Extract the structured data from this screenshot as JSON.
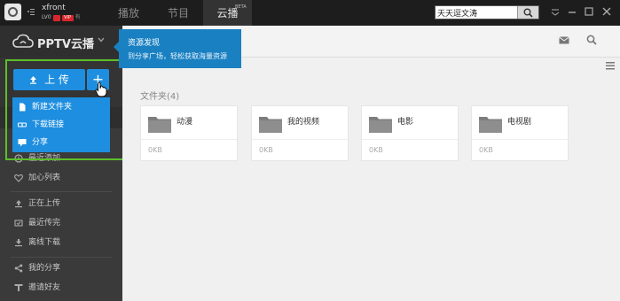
{
  "titlebar": {
    "user": {
      "name": "xfront",
      "level": "LV0",
      "vip": "VIP",
      "badge_text": "有"
    },
    "tabs": [
      {
        "label": "播放"
      },
      {
        "label": "节目"
      },
      {
        "label": "云播",
        "badge": "BETA"
      }
    ],
    "search": {
      "value": "天天逗文涛",
      "placeholder": ""
    },
    "icons": [
      "app-logo-icon",
      "menu-icon",
      "search-icon",
      "dropdown-icon",
      "minimize-icon",
      "maximize-icon",
      "close-icon"
    ]
  },
  "sidebar": {
    "brand": "PPTV云播",
    "upload_label": "上 传",
    "plus_label": "+",
    "dropdown": [
      {
        "label": "新建文件夹",
        "icon": "new-folder-icon"
      },
      {
        "label": "下载链接",
        "icon": "link-icon"
      },
      {
        "label": "分享",
        "icon": "share-icon"
      }
    ],
    "items": [
      {
        "label": "最近添加",
        "icon": "recent-icon"
      },
      {
        "label": "加心列表",
        "icon": "heart-icon"
      },
      {
        "label": "正在上传",
        "icon": "upload-icon"
      },
      {
        "label": "最近传完",
        "icon": "done-icon"
      },
      {
        "label": "离线下载",
        "icon": "download-icon"
      },
      {
        "label": "我的分享",
        "icon": "share-icon"
      },
      {
        "label": "邀请好友",
        "icon": "invite-icon"
      }
    ]
  },
  "tooltip": {
    "title": "资源发现",
    "body": "到分享广场，轻松获取海量资源"
  },
  "main": {
    "section_title": "文件夹(4)",
    "folders": [
      {
        "name": "动漫",
        "size": "0KB"
      },
      {
        "name": "我的视频",
        "size": "0KB"
      },
      {
        "name": "电影",
        "size": "0KB"
      },
      {
        "name": "电视剧",
        "size": "0KB"
      }
    ]
  },
  "colors": {
    "accent": "#1e8ee0",
    "tooltip": "#1980c2",
    "highlight_frame": "#5cbf2a",
    "titlebar": "#1d1d1d",
    "sidebar": "#3a3a3a"
  }
}
